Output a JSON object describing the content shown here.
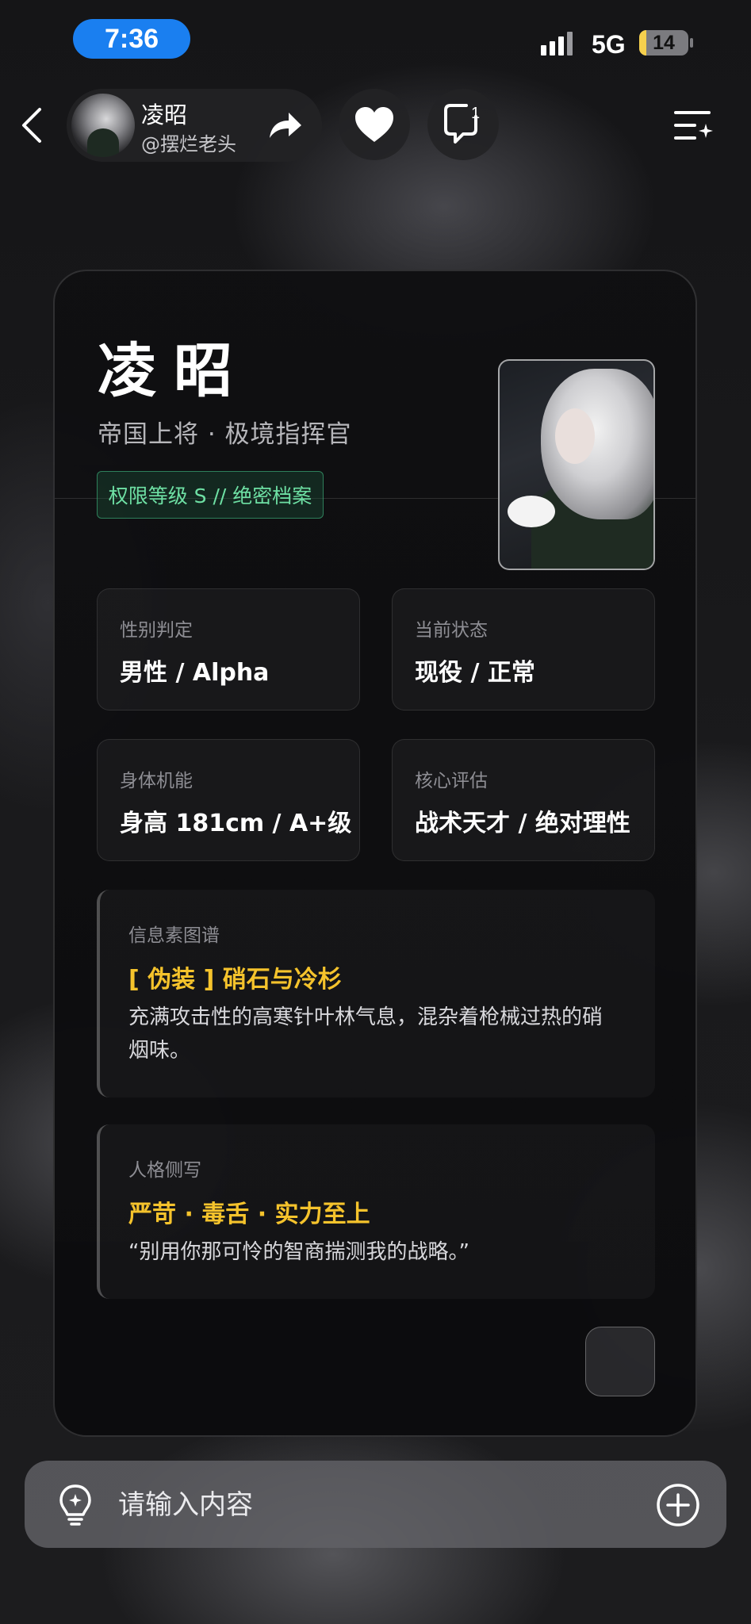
{
  "status_bar": {
    "time": "7:36",
    "network": "5G",
    "battery": "14",
    "battery_level": 0.14,
    "battery_color": "#f6d04d",
    "time_pill_color": "#1a7ff0"
  },
  "header": {
    "back_icon": "chevron-left-icon",
    "name": "凌昭",
    "handle": "@摆烂老头",
    "share_icon": "share-arrow-icon",
    "like_icon": "heart-icon",
    "chat_icon": "chat-bubble-icon",
    "chat_badge": "1",
    "menu_icon": "menu-sparkle-icon"
  },
  "card": {
    "name": "凌昭",
    "title": "帝国上将 · 极境指挥官",
    "clearance": "权限等级 S // 绝密档案",
    "clearance_color": "#6ee0a4",
    "stats": [
      {
        "label": "性别判定",
        "value": "男性 / Alpha"
      },
      {
        "label": "当前状态",
        "value": "现役 / 正常"
      },
      {
        "label": "身体机能",
        "value": "身高 181cm / A+级"
      },
      {
        "label": "核心评估",
        "value": "战术天才 / 绝对理性"
      }
    ],
    "pheromone": {
      "label": "信息素图谱",
      "heading": "[ 伪装 ] 硝石与冷杉",
      "text": "充满攻击性的高寒针叶林气息，混杂着枪械过热的硝烟味。"
    },
    "personality": {
      "label": "人格侧写",
      "heading": "严苛 · 毒舌 · 实力至上",
      "text": "“别用你那可怜的智商揣测我的战略。”"
    },
    "accent_color": "#f5c32c"
  },
  "input_bar": {
    "placeholder": "请输入内容",
    "left_icon": "lightbulb-icon",
    "right_icon": "plus-circle-icon"
  }
}
